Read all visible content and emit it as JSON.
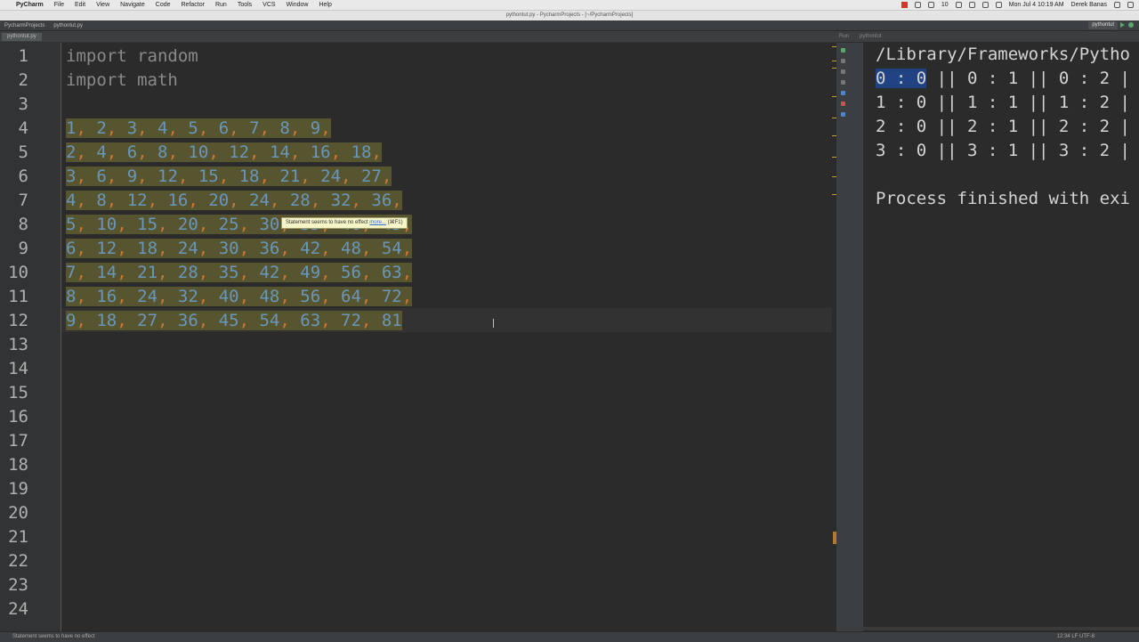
{
  "menubar": {
    "app": "PyCharm",
    "items": [
      "File",
      "Edit",
      "View",
      "Navigate",
      "Code",
      "Refactor",
      "Run",
      "Tools",
      "VCS",
      "Window",
      "Help"
    ],
    "battery_text": "10",
    "clock": "Mon Jul 4  10:19 AM",
    "user": "Derek Banas"
  },
  "window": {
    "title": "pythontut.py - PycharmProjects - [~/PycharmProjects]"
  },
  "nav": {
    "breadcrumbs": [
      "PycharmProjects",
      "pythontut.py"
    ],
    "run_config": "pythontut"
  },
  "editor": {
    "tab": "pythontut.py",
    "lines": [
      {
        "n": "1",
        "text": "import random",
        "selected": false,
        "kind": "kw"
      },
      {
        "n": "2",
        "text": "import math",
        "selected": false,
        "kind": "kw"
      },
      {
        "n": "3",
        "text": "",
        "selected": false,
        "kind": "kw"
      },
      {
        "n": "4",
        "text": "1, 2, 3, 4, 5, 6, 7, 8, 9,",
        "selected": true,
        "kind": "nums"
      },
      {
        "n": "5",
        "text": "2, 4, 6, 8, 10, 12, 14, 16, 18,",
        "selected": true,
        "kind": "nums"
      },
      {
        "n": "6",
        "text": "3, 6, 9, 12, 15, 18, 21, 24, 27,",
        "selected": true,
        "kind": "nums"
      },
      {
        "n": "7",
        "text": "4, 8, 12, 16, 20, 24, 28, 32, 36,",
        "selected": true,
        "kind": "nums"
      },
      {
        "n": "8",
        "text": "5, 10, 15, 20, 25, 30, 35, 40, 45,",
        "selected": true,
        "kind": "nums"
      },
      {
        "n": "9",
        "text": "6, 12, 18, 24, 30, 36, 42, 48, 54,",
        "selected": true,
        "kind": "nums"
      },
      {
        "n": "10",
        "text": "7, 14, 21, 28, 35, 42, 49, 56, 63,",
        "selected": true,
        "kind": "nums"
      },
      {
        "n": "11",
        "text": "8, 16, 24, 32, 40, 48, 56, 64, 72,",
        "selected": true,
        "kind": "nums"
      },
      {
        "n": "12",
        "text": "9, 18, 27, 36, 45, 54, 63, 72, 81",
        "selected": true,
        "kind": "nums"
      }
    ],
    "gutter_numbers": [
      "1",
      "2",
      "3",
      "4",
      "5",
      "6",
      "7",
      "8",
      "9",
      "10",
      "11",
      "12",
      "13",
      "14",
      "15",
      "16",
      "17",
      "18",
      "19",
      "20",
      "21",
      "22",
      "23",
      "24"
    ],
    "tooltip": {
      "text": "Statement seems to have no effect",
      "link": "more...",
      "shortcut": "(⌘F1)"
    }
  },
  "run": {
    "label": "Run",
    "config": "pythontut",
    "output": [
      "/Library/Frameworks/Pytho",
      "0 : 0 || 0 : 1 || 0 : 2 |",
      "1 : 0 || 1 : 1 || 1 : 2 |",
      "2 : 0 || 2 : 1 || 2 : 2 |",
      "3 : 0 || 3 : 1 || 3 : 2 |",
      "",
      "Process finished with exi"
    ],
    "highlight": "0 : 0"
  },
  "status": {
    "message": "Statement seems to have no effect",
    "position": "12:34",
    "line_sep": "LF",
    "encoding": "UTF-8"
  },
  "colors": {
    "number": "#6897bb",
    "comma": "#cc7832",
    "selection": "#575430",
    "console_highlight": "#214283"
  }
}
